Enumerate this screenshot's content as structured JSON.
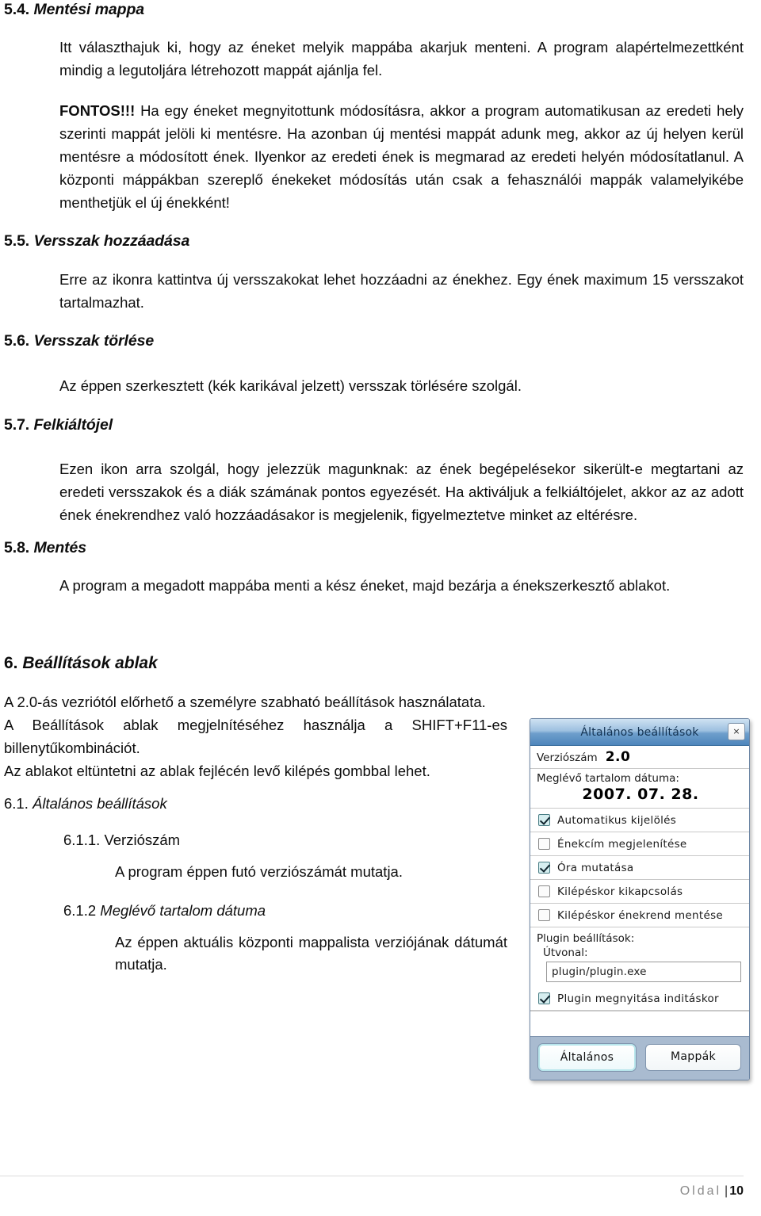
{
  "document": {
    "sections": [
      {
        "id": "5.4",
        "number": "5.4.",
        "title": "Mentési mappa",
        "paragraphs": [
          "Itt választhajuk ki, hogy az éneket melyik mappába akarjuk menteni.   A program alapértelmezettként mindig a legutoljára létrehozott mappát ajánlja fel.",
          "Ha egy éneket megnyitottunk módosításra, akkor a program automatikusan az eredeti hely szerinti mappát jelöli ki mentésre. Ha azonban új mentési mappát adunk meg, akkor az új helyen kerül mentésre a módosított ének. Ilyenkor az eredeti ének is megmarad az eredeti helyén módosítatlanul. A központi máppákban szereplő énekeket módosítás után csak a fehasználói mappák valamelyikébe menthetjük el új énekként!"
        ],
        "emphasis_lead": "FONTOS!!!"
      },
      {
        "id": "5.5",
        "number": "5.5.",
        "title": "Versszak hozzáadása",
        "paragraphs": [
          "Erre az ikonra kattintva új versszakokat lehet hozzáadni az énekhez. Egy ének maximum 15 versszakot tartalmazhat."
        ]
      },
      {
        "id": "5.6",
        "number": "5.6.",
        "title": "Versszak törlése",
        "paragraphs": [
          "Az éppen szerkesztett (kék karikával jelzett) versszak törlésére szolgál."
        ]
      },
      {
        "id": "5.7",
        "number": "5.7.",
        "title": "Felkiáltójel",
        "paragraphs": [
          "Ezen ikon arra szolgál, hogy jelezzük magunknak: az ének begépelésekor sikerült-e megtartani az eredeti versszakok és a diák számának pontos egyezését. Ha aktiváljuk a felkiáltójelet, akkor az az adott ének énekrendhez való hozzáadásakor is megjelenik, figyelmeztetve minket az eltérésre."
        ]
      },
      {
        "id": "5.8",
        "number": "5.8.",
        "title": "Mentés",
        "paragraphs": [
          "A program a megadott mappába menti a kész éneket, majd bezárja a énekszerkesztő ablakot."
        ]
      },
      {
        "id": "6",
        "number": "6.",
        "title": "Beállítások ablak",
        "paragraphs": [
          "A 2.0-ás vezriótól előrhető a személyre szabható beállítások használatata.",
          "A Beállítások ablak megjelnítéséhez használja a SHIFT+F11-es billenytűkombinációt.",
          "Az ablakot eltüntetni az ablak fejlécén levő kilépés gombbal lehet."
        ]
      },
      {
        "id": "6.1",
        "number": "6.1.",
        "title": "Általános beállítások",
        "paragraphs": []
      },
      {
        "id": "6.1.1",
        "number": "6.1.1.",
        "title": "Verziószám",
        "paragraphs": [
          "A program éppen futó verziószámát mutatja."
        ]
      },
      {
        "id": "6.1.2",
        "number": "6.1.2",
        "title": "Meglévő tartalom dátuma",
        "paragraphs": [
          "Az éppen aktuális központi mappalista verziójának dátumát mutatja."
        ]
      }
    ]
  },
  "dialog": {
    "title": "Általános beállítások",
    "close_icon": "close-icon",
    "close_glyph": "×",
    "version": {
      "label": "Verziószám",
      "value": "2.0"
    },
    "content_date": {
      "label": "Meglévő tartalom dátuma:",
      "value": "2007. 07. 28."
    },
    "checkboxes": [
      {
        "label": "Automatikus kijelölés",
        "checked": true
      },
      {
        "label": "Énekcím megjelenítése",
        "checked": false
      },
      {
        "label": "Óra mutatása",
        "checked": true
      },
      {
        "label": "Kilépéskor kikapcsolás",
        "checked": false
      },
      {
        "label": "Kilépéskor énekrend mentése",
        "checked": false
      }
    ],
    "plugin": {
      "heading": "Plugin beállítások:",
      "path_label": "Útvonal:",
      "path_value": "plugin/plugin.exe",
      "startup_checkbox": {
        "label": "Plugin megnyitása inditáskor",
        "checked": true
      }
    },
    "buttons": [
      {
        "label": "Általános",
        "active": true
      },
      {
        "label": "Mappák",
        "active": false
      }
    ],
    "colors": {
      "titlebar_top": "#cfe2f2",
      "titlebar_bottom": "#4e85bb",
      "footer_bar": "#a9bbd0",
      "checkbox_checked_fill": "#d6eef0"
    }
  },
  "footer": {
    "word": "Oldal",
    "separator": "|",
    "page_number": "10"
  }
}
